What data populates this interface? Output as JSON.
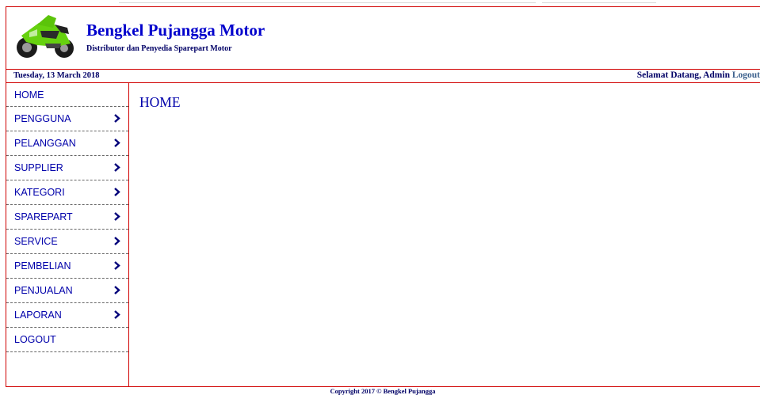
{
  "header": {
    "title": "Bengkel Pujangga Motor",
    "subtitle": "Distributor dan Penyedia Sparepart Motor"
  },
  "infobar": {
    "date": "Tuesday, 13 March 2018",
    "welcome": "Selamat Datang, Admin",
    "logout_link": "Logout"
  },
  "sidebar": {
    "items": [
      {
        "label": "HOME",
        "has_submenu": false
      },
      {
        "label": "PENGGUNA",
        "has_submenu": true
      },
      {
        "label": "PELANGGAN",
        "has_submenu": true
      },
      {
        "label": "SUPPLIER",
        "has_submenu": true
      },
      {
        "label": "KATEGORI",
        "has_submenu": true
      },
      {
        "label": "SPAREPART",
        "has_submenu": true
      },
      {
        "label": "SERVICE",
        "has_submenu": true
      },
      {
        "label": "PEMBELIAN",
        "has_submenu": true
      },
      {
        "label": "PENJUALAN",
        "has_submenu": true
      },
      {
        "label": "LAPORAN",
        "has_submenu": true
      },
      {
        "label": "LOGOUT",
        "has_submenu": false
      }
    ]
  },
  "main": {
    "heading": "HOME"
  },
  "footer": {
    "copyright": "Copyright 2017 © Bengkel Pujangga"
  },
  "colors": {
    "border": "#d00000",
    "title": "#0000cc",
    "menu_text": "#0000aa",
    "logout_link": "#3a5f8c"
  },
  "icons": {
    "logo": "motorcycle-logo-icon",
    "menu_arrow": "chevron-right-icon"
  }
}
